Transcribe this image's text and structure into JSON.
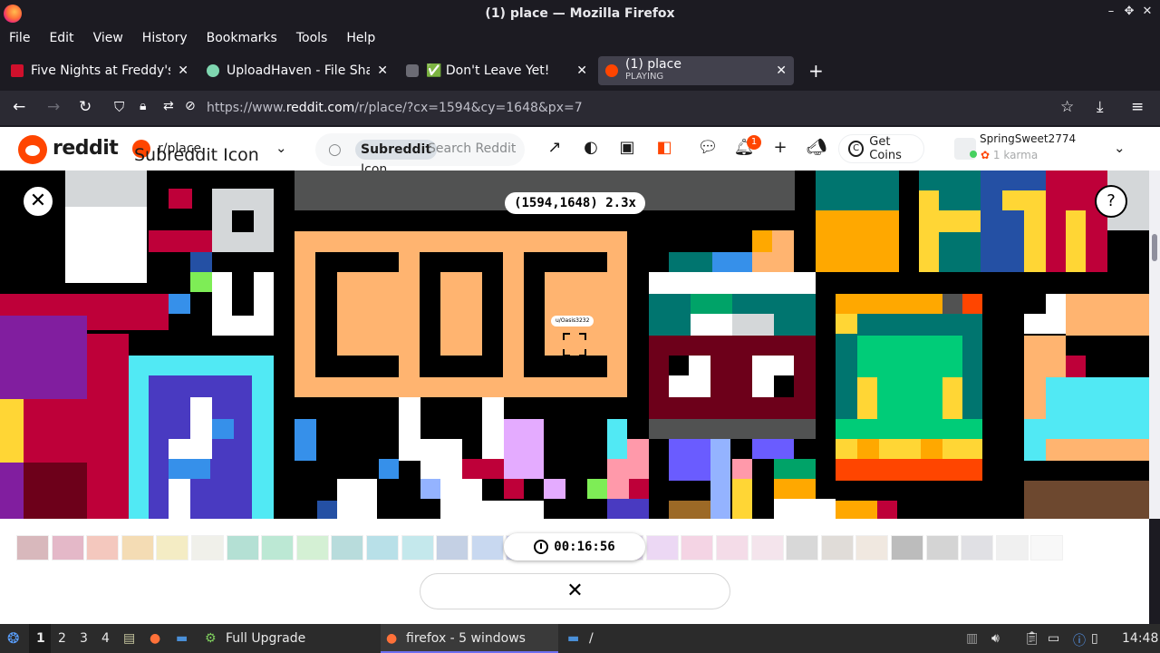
{
  "window": {
    "title": "(1) place — Mozilla Firefox",
    "controls": [
      "–",
      "✥",
      "✕"
    ]
  },
  "menu": [
    "File",
    "Edit",
    "View",
    "History",
    "Bookmarks",
    "Tools",
    "Help"
  ],
  "tabs": [
    {
      "label": "Five Nights at Freddy's: S",
      "close": "✕"
    },
    {
      "label": "UploadHaven - File Sharin",
      "close": "✕"
    },
    {
      "label": "✅ Don't Leave Yet!",
      "close": "✕"
    },
    {
      "label": "(1) place",
      "sub": "PLAYING",
      "close": "✕"
    }
  ],
  "newtab": "+",
  "url": {
    "prefix": "https://www.",
    "domain": "reddit.com",
    "path": "/r/place/?cx=1594&cy=1648&px=7"
  },
  "reddit": {
    "wordmark": "reddit",
    "subreddit": "r/place",
    "subreddit_alt": "Subreddit Icon",
    "search_pill": "Subreddit",
    "search_pill_alt": "r/place",
    "search_alt": "Icon",
    "search_placeholder": "Search Reddit",
    "notif_count": "1",
    "get_coins": "Get Coins",
    "username": "SpringSweet2774",
    "karma": "1 karma"
  },
  "canvas": {
    "coords": "(1594,1648) 2.3x",
    "user_tag": "u/Oasis3232",
    "close_glyph": "✕",
    "help_glyph": "?"
  },
  "palette": {
    "timer": "00:16:56",
    "colors": [
      "#d8b8bc",
      "#e4b8c8",
      "#f4c8be",
      "#f4dcb4",
      "#f4ecc4",
      "#f0f0ea",
      "#b4e0d4",
      "#bce8d4",
      "#d4f0d4",
      "#b8dcdc",
      "#b8e0e8",
      "#c4e8ec",
      "#c4d0e4",
      "#c8d8f0",
      "#d0d4f0",
      "#dcd0ec",
      "#d4c8ec",
      "#e4d8f0",
      "#ecd8f4",
      "#f4d4e4",
      "#f4dce8",
      "#f4e4ec",
      "#d8d8d8",
      "#e0dcd8",
      "#f0e8e0",
      "#bcbcbc",
      "#d4d4d4",
      "#e0e0e4",
      "#f0f0f0",
      "#f8f8f8"
    ],
    "close_glyph": "✕"
  },
  "taskbar": {
    "workspaces": [
      "1",
      "2",
      "3",
      "4"
    ],
    "upgrade": "Full Upgrade",
    "firefox": "firefox - 5 windows",
    "folder": "/",
    "clock": "14:48"
  }
}
